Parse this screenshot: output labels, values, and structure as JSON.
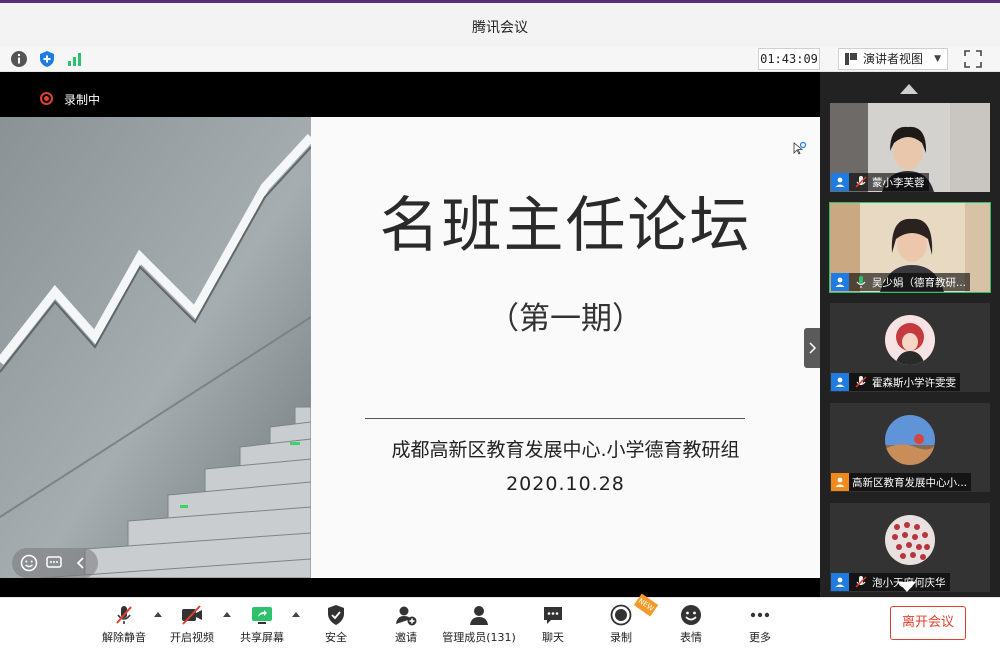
{
  "window": {
    "title": "腾讯会议"
  },
  "infobar": {
    "timer": "01:43:09",
    "view_label": "演讲者视图"
  },
  "stage": {
    "recording_label": "录制中",
    "slide": {
      "title": "名班主任论坛",
      "subtitle": "（第一期）",
      "organization": "成都高新区教育发展中心.小学德育教研组",
      "date": "2020.10.28"
    }
  },
  "participants": [
    {
      "name": "蒙小李芙蓉",
      "mic": "muted",
      "badge": "blue",
      "active": false
    },
    {
      "name": "吴少娟（德育教研...",
      "mic": "on",
      "badge": "blue",
      "active": true
    },
    {
      "name": "霍森斯小学许雯雯",
      "mic": "muted",
      "badge": "blue",
      "active": false
    },
    {
      "name": "高新区教育发展中心小...",
      "mic": "none",
      "badge": "orange",
      "active": false
    },
    {
      "name": "泡小天府何庆华",
      "mic": "muted",
      "badge": "blue",
      "active": false
    }
  ],
  "toolbar": {
    "unmute": "解除静音",
    "video": "开启视频",
    "share": "共享屏幕",
    "security": "安全",
    "invite": "邀请",
    "members": "管理成员(131)",
    "chat": "聊天",
    "record": "录制",
    "reactions": "表情",
    "more": "更多",
    "leave": "离开会议",
    "new_badge": "NEW"
  },
  "colors": {
    "accent_blue": "#1f7be0",
    "record_red": "#e0412f",
    "active_green": "#2ec16b",
    "leave_red": "#e0412f"
  }
}
